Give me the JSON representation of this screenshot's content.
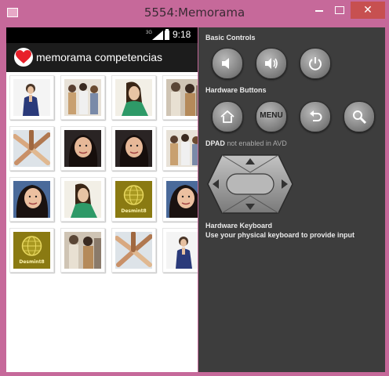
{
  "window": {
    "title": "5554:Memorama",
    "min_symbol": "—",
    "max_symbol": "□",
    "close_symbol": "✕"
  },
  "status_bar": {
    "network_label": "3G",
    "time": "9:18"
  },
  "app": {
    "title": "memorama competencias",
    "icon": "heart-icon"
  },
  "cards": [
    {
      "id": "r1c1",
      "content": "girl-praying"
    },
    {
      "id": "r1c2",
      "content": "group-people"
    },
    {
      "id": "r1c3",
      "content": "girl-green-top"
    },
    {
      "id": "r1c4",
      "content": "girl-crowd"
    },
    {
      "id": "r2c1",
      "content": "hands-together"
    },
    {
      "id": "r2c2",
      "content": "girl-dark-hair"
    },
    {
      "id": "r2c3",
      "content": "girl-dark-hair"
    },
    {
      "id": "r2c4",
      "content": "group-people"
    },
    {
      "id": "r3c1",
      "content": "girl-selfie"
    },
    {
      "id": "r3c2",
      "content": "girl-green-top"
    },
    {
      "id": "r3c3",
      "content": "globe-logo",
      "caption": "Desmint8"
    },
    {
      "id": "r3c4",
      "content": "girl-selfie"
    },
    {
      "id": "r4c1",
      "content": "globe-logo",
      "caption": "Desmint8"
    },
    {
      "id": "r4c2",
      "content": "girl-crowd"
    },
    {
      "id": "r4c3",
      "content": "hands-together"
    },
    {
      "id": "r4c4",
      "content": "girl-praying"
    }
  ],
  "controls": {
    "basic_title": "Basic Controls",
    "hardware_title": "Hardware Buttons",
    "menu_label": "MENU",
    "dpad_title": "DPAD",
    "dpad_note": "not enabled in AVD",
    "keyboard_title": "Hardware Keyboard",
    "keyboard_note": "Use your physical keyboard to provide input",
    "icons": [
      "volume-down-icon",
      "volume-up-icon",
      "power-icon",
      "home-icon",
      "menu-icon",
      "back-icon",
      "search-icon"
    ]
  },
  "colors": {
    "window_frame": "#c6699a",
    "close_button": "#c75050",
    "controls_bg": "#3d3d3d",
    "action_bar": "#1c1c1c",
    "heart": "#e8202a"
  }
}
